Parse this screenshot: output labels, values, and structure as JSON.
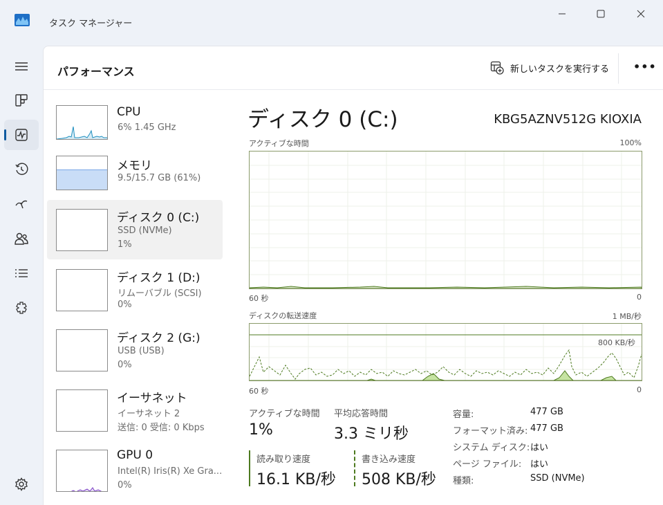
{
  "window": {
    "title": "タスク マネージャー",
    "app_icon": "task-manager-icon"
  },
  "nav": {
    "items": [
      {
        "name": "hamburger-menu-icon"
      },
      {
        "name": "processes-icon"
      },
      {
        "name": "performance-icon",
        "active": true
      },
      {
        "name": "app-history-icon"
      },
      {
        "name": "startup-apps-icon"
      },
      {
        "name": "users-icon"
      },
      {
        "name": "details-icon"
      },
      {
        "name": "services-icon"
      },
      {
        "name": "settings-icon"
      }
    ]
  },
  "header": {
    "title": "パフォーマンス",
    "run_task_label": "新しいタスクを実行する",
    "more_label": "•••"
  },
  "sidebar": {
    "items": [
      {
        "title": "CPU",
        "sub1": "6%  1.45 GHz",
        "sub2": ""
      },
      {
        "title": "メモリ",
        "sub1": "9.5/15.7 GB (61%)",
        "sub2": ""
      },
      {
        "title": "ディスク 0 (C:)",
        "sub1": "SSD (NVMe)",
        "sub2": "1%"
      },
      {
        "title": "ディスク 1 (D:)",
        "sub1": "リムーバブル (SCSI)",
        "sub2": "0%"
      },
      {
        "title": "ディスク 2 (G:)",
        "sub1": "USB (USB)",
        "sub2": "0%"
      },
      {
        "title": "イーサネット",
        "sub1": "イーサネット 2",
        "sub2": "送信: 0  受信: 0 Kbps"
      },
      {
        "title": "GPU 0",
        "sub1": "Intel(R) Iris(R) Xe Gra...",
        "sub2": "0%"
      }
    ],
    "memory_usage_fraction": 0.61
  },
  "detail": {
    "title": "ディスク 0 (C:)",
    "model": "KBG5AZNV512G KIOXIA",
    "active_time_graph": {
      "label": "アクティブな時間",
      "max_label": "100%",
      "x_left": "60 秒",
      "x_right": "0"
    },
    "transfer_graph": {
      "label": "ディスクの転送速度",
      "max_label": "1 MB/秒",
      "line_label": "800 KB/秒",
      "x_left": "60 秒",
      "x_right": "0"
    },
    "stats": {
      "active_time_label": "アクティブな時間",
      "active_time_value": "1%",
      "response_label": "平均応答時間",
      "response_value": "3.3 ミリ秒",
      "read_label": "読み取り速度",
      "read_value": "16.1 KB/秒",
      "write_label": "書き込み速度",
      "write_value": "508 KB/秒"
    },
    "properties": [
      {
        "label": "容量:",
        "value": "477 GB"
      },
      {
        "label": "フォーマット済み:",
        "value": "477 GB"
      },
      {
        "label": "システム ディスク:",
        "value": "はい"
      },
      {
        "label": "ページ ファイル:",
        "value": "はい"
      },
      {
        "label": "種類:",
        "value": "SSD (NVMe)"
      }
    ]
  },
  "colors": {
    "disk_graph": "#4d7a1f",
    "cpu_graph": "#1f8fbf",
    "memory_graph": "#7aa7e6",
    "gpu_graph": "#7a3fc4"
  }
}
